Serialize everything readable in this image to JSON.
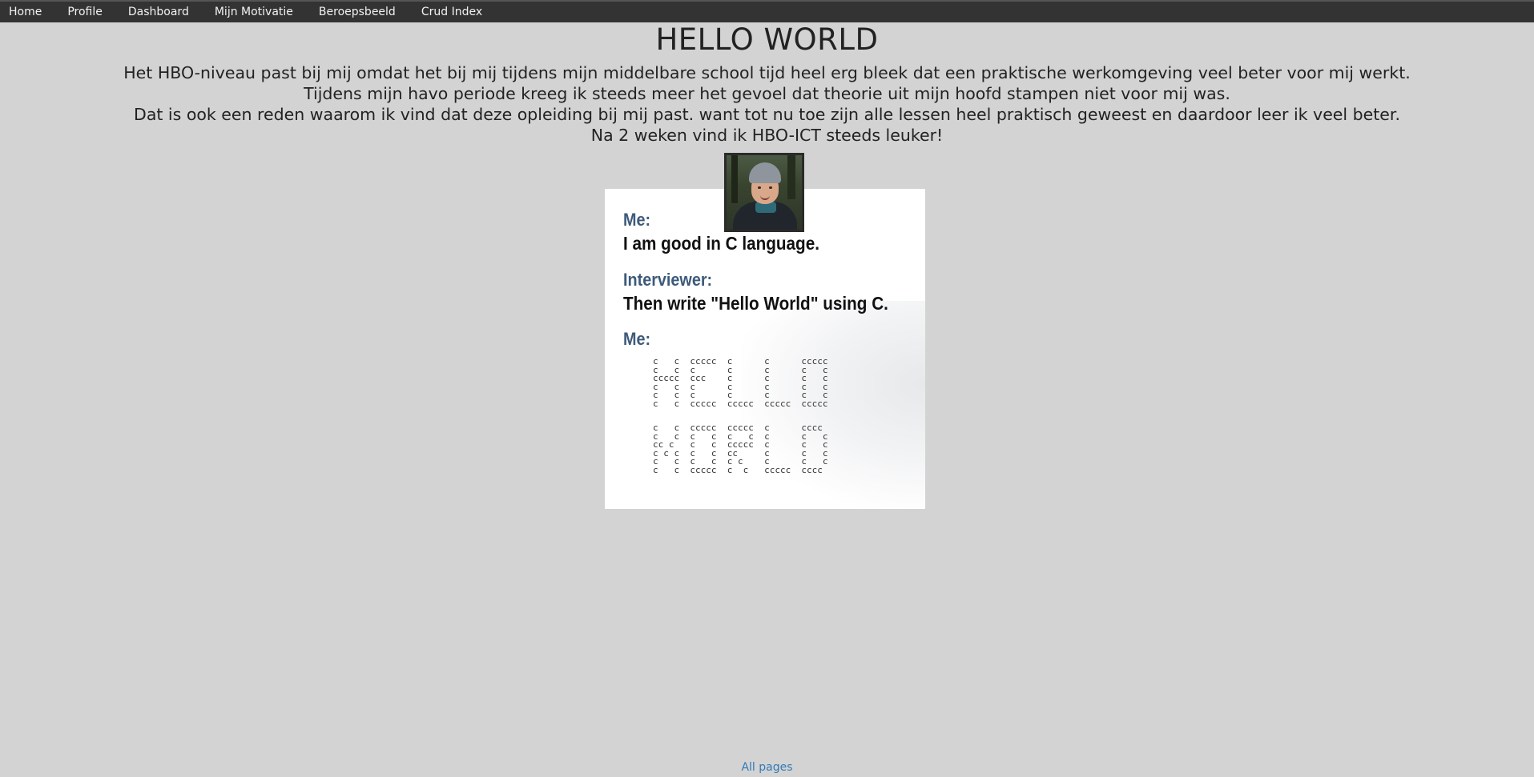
{
  "nav": {
    "items": [
      {
        "label": "Home"
      },
      {
        "label": "Profile"
      },
      {
        "label": "Dashboard"
      },
      {
        "label": "Mijn Motivatie"
      },
      {
        "label": "Beroepsbeeld"
      },
      {
        "label": "Crud Index"
      }
    ]
  },
  "main": {
    "title": "HELLO WORLD",
    "paragraphs": [
      "Het HBO-niveau past bij mij omdat het bij mij tijdens mijn middelbare school tijd heel erg bleek dat een praktische werkomgeving veel beter voor mij werkt.",
      "Tijdens mijn havo periode kreeg ik steeds meer het gevoel dat theorie uit mijn hoofd stampen niet voor mij was.",
      "Dat is ook een reden waarom ik vind dat deze opleiding bij mij past. want tot nu toe zijn alle lessen heel praktisch geweest en daardoor leer ik veel beter.",
      "Na 2 weken vind ik HBO-ICT steeds leuker!"
    ]
  },
  "comic": {
    "speaker1": "Me:",
    "line1": "I am good in C language.",
    "speaker2": "Interviewer:",
    "line2": "Then write \"Hello World\" using C.",
    "speaker3": "Me:",
    "art_top": "c   c  ccccc  c      c      ccccc\nc   c  c      c      c      c   c\nccccc  ccc    c      c      c   c\nc   c  c      c      c      c   c\nc   c  c      c      c      c   c\nc   c  ccccc  ccccc  ccccc  ccccc",
    "art_bottom": "c   c  ccccc  ccccc  c      cccc\nc   c  c   c  c   c  c      c   c\ncc c   c   c  ccccc  c      c   c\nc c c  c   c  cc     c      c   c\nc   c  c   c  c c    c      c   c\nc   c  ccccc  c  c   ccccc  cccc"
  },
  "footer": {
    "link": "All pages"
  }
}
